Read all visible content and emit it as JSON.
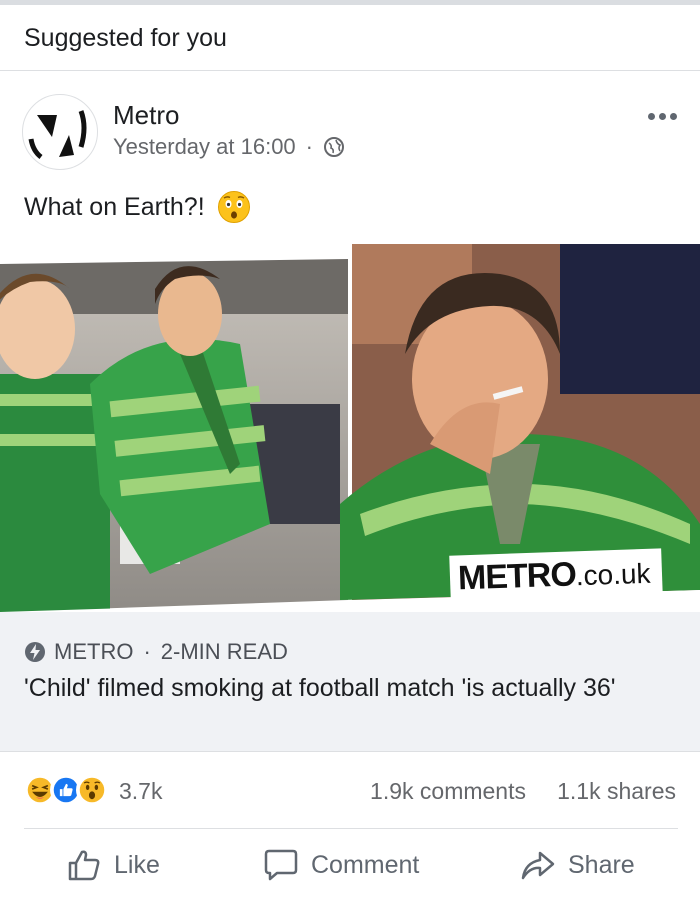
{
  "feed": {
    "section_label": "Suggested for you"
  },
  "post": {
    "page_name": "Metro",
    "timestamp": "Yesterday at 16:00",
    "separator": "·",
    "audience_icon": "globe-icon",
    "caption": "What on Earth?!",
    "caption_emoji": "astonished-face-emoji",
    "media_watermark": {
      "brand": "METRO",
      "suffix": ".co.uk"
    }
  },
  "link": {
    "source": "METRO",
    "read_time": "2-MIN READ",
    "title": "'Child' filmed smoking at football match 'is actually 36'"
  },
  "stats": {
    "reaction_icons": [
      "haha-icon",
      "like-icon",
      "wow-icon"
    ],
    "reaction_count": "3.7k",
    "comments": "1.9k comments",
    "shares": "1.1k shares"
  },
  "actions": {
    "like": "Like",
    "comment": "Comment",
    "share": "Share"
  },
  "colors": {
    "like_blue": "#1877f2",
    "reaction_yellow": "#f7b928",
    "text_secondary": "#65676b"
  }
}
